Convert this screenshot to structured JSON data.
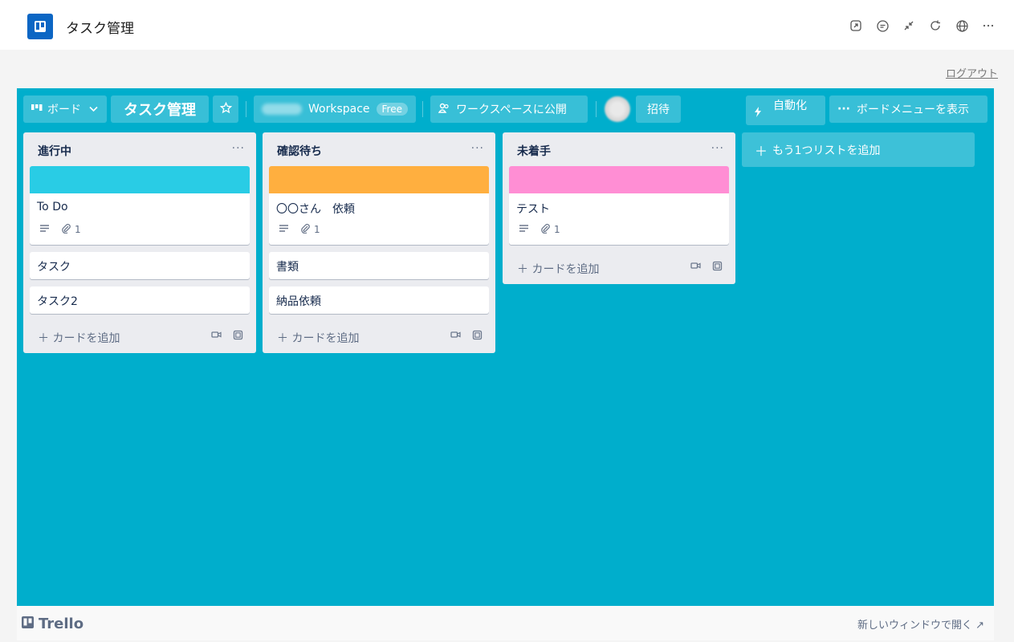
{
  "app": {
    "title": "タスク管理"
  },
  "header_icons": [
    "open-external-icon",
    "comment-icon",
    "collapse-icon",
    "refresh-icon",
    "globe-icon",
    "more-icon"
  ],
  "logout_label": "ログアウト",
  "board": {
    "background_color": "#00aecc",
    "view_label": "ボード",
    "title": "タスク管理",
    "workspace_label": "Workspace",
    "free_badge": "Free",
    "visibility_label": "ワークスペースに公開",
    "invite_label": "招待",
    "automation_label": "自動化",
    "menu_label": "ボードメニューを表示",
    "add_list_label": "もう1つリストを追加"
  },
  "lists": [
    {
      "title": "進行中",
      "menu": "···",
      "cards": [
        {
          "title": "To Do",
          "cover_color": "#29cce5",
          "attachments": "1"
        },
        {
          "title": "タスク"
        },
        {
          "title": "タスク2"
        }
      ],
      "add_card_label": "カードを追加"
    },
    {
      "title": "確認待ち",
      "menu": "···",
      "cards": [
        {
          "title": "〇〇さん　依頼",
          "cover_color": "#ffaf3f",
          "attachments": "1"
        },
        {
          "title": "書類"
        },
        {
          "title": "納品依頼"
        }
      ],
      "add_card_label": "カードを追加"
    },
    {
      "title": "未着手",
      "menu": "···",
      "cards": [
        {
          "title": "テスト",
          "cover_color": "#ff8ed4",
          "attachments": "1"
        }
      ],
      "add_card_label": "カードを追加"
    }
  ],
  "footer": {
    "brand": "Trello",
    "open_new_window": "新しいウィンドウで開く ↗"
  }
}
